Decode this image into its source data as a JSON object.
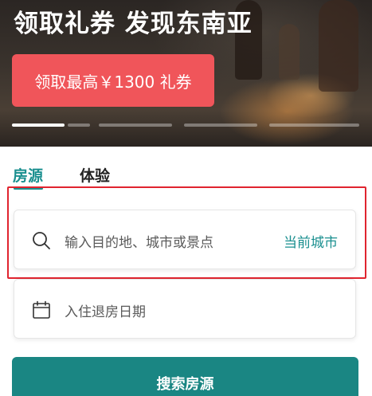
{
  "hero": {
    "title": "领取礼券 发现东南亚",
    "coupon_button_label": "领取最高￥1300 礼券",
    "carousel_count": 5,
    "carousel_active_index": 0
  },
  "tabs": [
    {
      "label": "房源",
      "active": true
    },
    {
      "label": "体验",
      "active": false
    }
  ],
  "search": {
    "placeholder": "输入目的地、城市或景点",
    "current_city_label": "当前城市",
    "icon": "search-icon"
  },
  "dates": {
    "placeholder": "入住退房日期",
    "icon": "calendar-icon"
  },
  "submit": {
    "label": "搜索房源"
  },
  "colors": {
    "accent": "#1a8f8f",
    "button": "#1a8683",
    "coupon": "#f0555a",
    "highlight": "#e0242f"
  }
}
